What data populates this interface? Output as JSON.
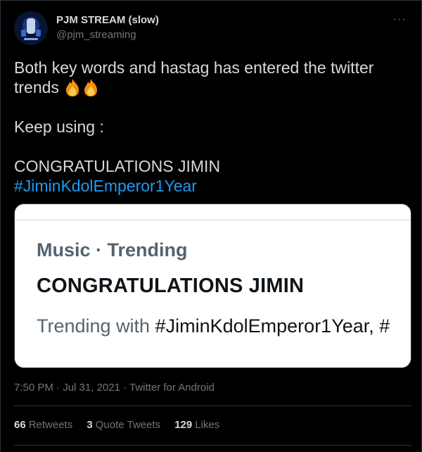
{
  "tweet": {
    "author": {
      "display_name": "PJM STREAM (slow)",
      "handle": "@pjm_streaming",
      "avatar_text": "PJM STREAM"
    },
    "more_label": "···",
    "text": {
      "line1": "Both key words and hastag has entered the twitter",
      "line2": "trends",
      "emoji": "fire-emoji",
      "line3": "Keep using :",
      "line4": "CONGRATULATIONS JIMIN",
      "hashtag": "#JiminKdolEmperor1Year"
    },
    "media_card": {
      "context": "Music · Trending",
      "title": "CONGRATULATIONS JIMIN",
      "trending_prefix": "Trending with ",
      "trending_tag": "#JiminKdolEmperor1Year, #"
    },
    "meta": {
      "time": "7:50 PM",
      "separator": " · ",
      "date": "Jul 31, 2021",
      "source": "Twitter for Android"
    },
    "stats": {
      "retweets_count": "66",
      "retweets_label": "Retweets",
      "quotes_count": "3",
      "quotes_label": "Quote Tweets",
      "likes_count": "129",
      "likes_label": "Likes"
    }
  },
  "colors": {
    "background": "#000000",
    "text": "#d9d9d9",
    "secondary": "#6e767d",
    "link": "#1d9bf0",
    "divider": "#2f3336"
  }
}
